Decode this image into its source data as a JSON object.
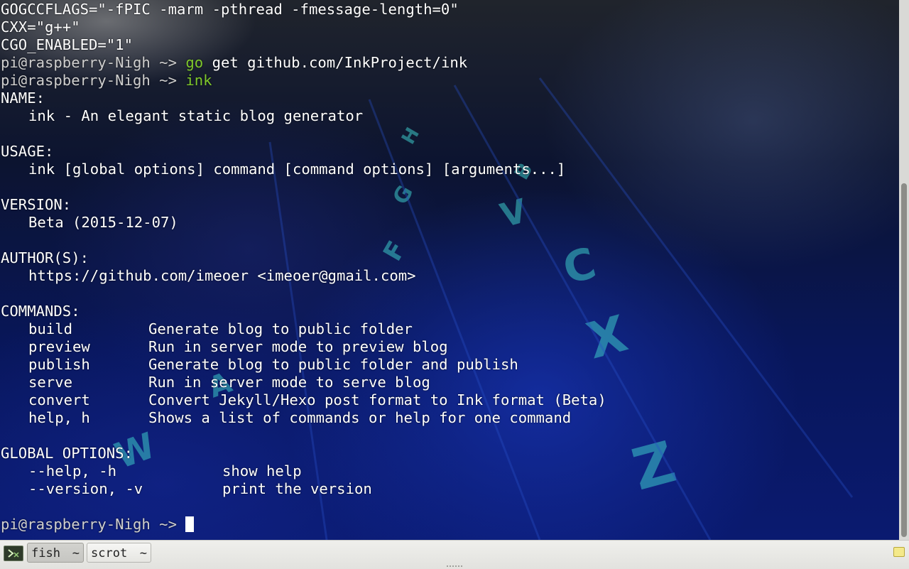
{
  "terminal": {
    "lines": [
      {
        "segments": [
          {
            "text": "GOGCCFLAGS=\"-fPIC -marm -pthread -fmessage-length=0\""
          }
        ]
      },
      {
        "segments": [
          {
            "text": "CXX=\"g++\""
          }
        ]
      },
      {
        "segments": [
          {
            "text": "CGO_ENABLED=\"1\""
          }
        ]
      },
      {
        "prompt": "pi@raspberry-Nigh ~> ",
        "cmd": "go",
        "args": " get github.com/InkProject/ink"
      },
      {
        "prompt": "pi@raspberry-Nigh ~> ",
        "cmd": "ink",
        "args": ""
      },
      {
        "segments": [
          {
            "text": "NAME:"
          }
        ]
      },
      {
        "indent": true,
        "segments": [
          {
            "text": "ink - An elegant static blog generator"
          }
        ]
      },
      {
        "segments": [
          {
            "text": ""
          }
        ]
      },
      {
        "segments": [
          {
            "text": "USAGE:"
          }
        ]
      },
      {
        "indent": true,
        "segments": [
          {
            "text": "ink [global options] command [command options] [arguments...]"
          }
        ]
      },
      {
        "segments": [
          {
            "text": ""
          }
        ]
      },
      {
        "segments": [
          {
            "text": "VERSION:"
          }
        ]
      },
      {
        "indent": true,
        "segments": [
          {
            "text": "Beta (2015-12-07)"
          }
        ]
      },
      {
        "segments": [
          {
            "text": ""
          }
        ]
      },
      {
        "segments": [
          {
            "text": "AUTHOR(S):"
          }
        ]
      },
      {
        "indent": true,
        "segments": [
          {
            "text": "https://github.com/imeoer <imeoer@gmail.com>"
          }
        ]
      },
      {
        "segments": [
          {
            "text": ""
          }
        ]
      },
      {
        "segments": [
          {
            "text": "COMMANDS:"
          }
        ]
      },
      {
        "command": "build",
        "desc": "Generate blog to public folder"
      },
      {
        "command": "preview",
        "desc": "Run in server mode to preview blog"
      },
      {
        "command": "publish",
        "desc": "Generate blog to public folder and publish"
      },
      {
        "command": "serve",
        "desc": "Run in server mode to serve blog"
      },
      {
        "command": "convert",
        "desc": "Convert Jekyll/Hexo post format to Ink format (Beta)"
      },
      {
        "command": "help, h",
        "desc": "Shows a list of commands or help for one command"
      },
      {
        "segments": [
          {
            "text": ""
          }
        ]
      },
      {
        "segments": [
          {
            "text": "GLOBAL OPTIONS:"
          }
        ]
      },
      {
        "option": "--help, -h",
        "desc": "show help"
      },
      {
        "option": "--version, -v",
        "desc": "print the version"
      },
      {
        "segments": [
          {
            "text": ""
          }
        ]
      },
      {
        "prompt": "pi@raspberry-Nigh ~> ",
        "cursor": true
      }
    ]
  },
  "taskbar": {
    "start_icon": "terminal-menu-icon",
    "tasks": [
      {
        "label": "fish",
        "suffix": "~",
        "active": true
      },
      {
        "label": "scrot",
        "suffix": "~",
        "active": false
      }
    ],
    "tray_icon": "notification-icon"
  },
  "colors": {
    "command_green": "#7fc92c",
    "text": "#ffffff",
    "taskbar_bg": "#e8e8e4"
  }
}
